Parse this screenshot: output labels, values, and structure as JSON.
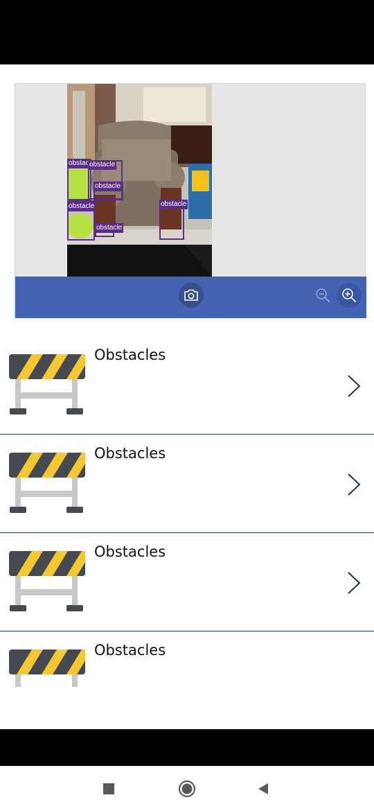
{
  "camera": {
    "detections": [
      {
        "label": "obstacle"
      },
      {
        "label": "obstacle"
      },
      {
        "label": "obstacle"
      },
      {
        "label": "obstacle"
      },
      {
        "label": "obstacle"
      },
      {
        "label": "obstacle"
      }
    ],
    "toolbar": {
      "camera_icon": "camera-icon",
      "zoom_out_icon": "zoom-out-icon",
      "zoom_in_icon": "zoom-in-icon"
    }
  },
  "list": {
    "items": [
      {
        "title": "Obstacles"
      },
      {
        "title": "Obstacles"
      },
      {
        "title": "Obstacles"
      },
      {
        "title": "Obstacles"
      }
    ]
  },
  "colors": {
    "toolbar": "#4262b3",
    "detection": "#5b2d8a",
    "divider": "#1f3266",
    "chevron": "#1a2a6c",
    "barrier_yellow": "#f6c830",
    "barrier_dark": "#454a52"
  },
  "nav": {
    "recent_icon": "square-icon",
    "home_icon": "circle-icon",
    "back_icon": "triangle-back-icon"
  }
}
